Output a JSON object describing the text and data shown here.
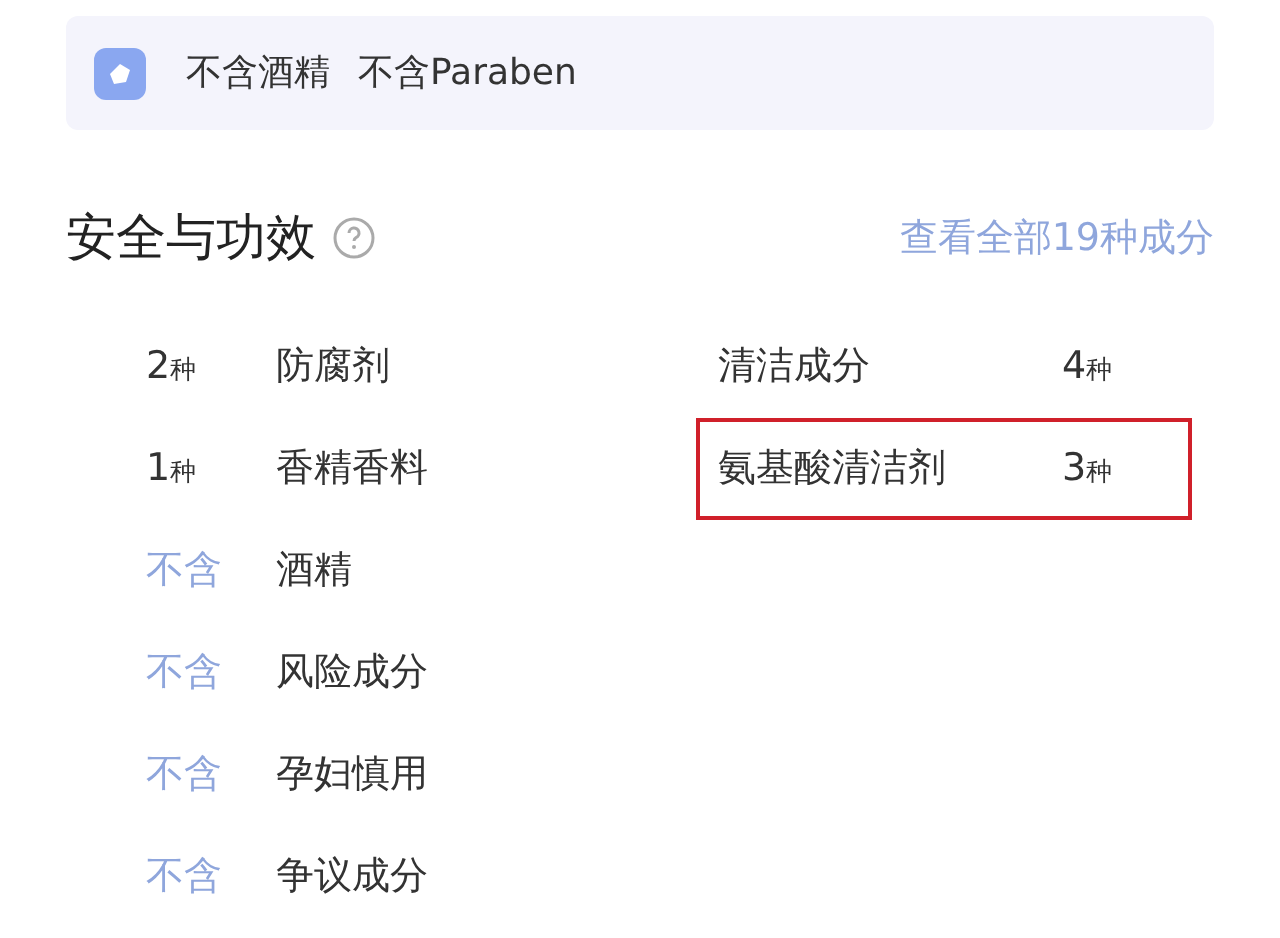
{
  "banner": {
    "tags": [
      "不含酒精",
      "不含Paraben"
    ]
  },
  "section": {
    "title": "安全与功效",
    "link": "查看全部19种成分"
  },
  "left_rows": [
    {
      "kind": "count",
      "value": "2",
      "unit": "种",
      "name": "防腐剂"
    },
    {
      "kind": "count",
      "value": "1",
      "unit": "种",
      "name": "香精香料"
    },
    {
      "kind": "absent",
      "value": "不含",
      "name": "酒精"
    },
    {
      "kind": "absent",
      "value": "不含",
      "name": "风险成分"
    },
    {
      "kind": "absent",
      "value": "不含",
      "name": "孕妇慎用"
    },
    {
      "kind": "absent",
      "value": "不含",
      "name": "争议成分"
    }
  ],
  "right_rows": [
    {
      "name": "清洁成分",
      "value": "4",
      "unit": "种",
      "highlighted": false
    },
    {
      "name": "氨基酸清洁剂",
      "value": "3",
      "unit": "种",
      "highlighted": true
    }
  ]
}
